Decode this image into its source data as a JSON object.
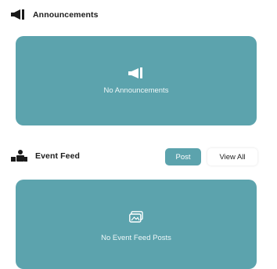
{
  "announcements": {
    "title": "Announcements",
    "icon": "megaphone-icon",
    "empty_text": "No Announcements"
  },
  "event_feed": {
    "title": "Event Feed",
    "icon": "people-icon",
    "post_label": "Post",
    "view_all_label": "View All",
    "empty_text": "No Event Feed Posts",
    "empty_icon": "image-gallery-icon"
  },
  "colors": {
    "accent": "#5ca3ad",
    "text": "#1a1a1a",
    "background": "#ffffff"
  }
}
